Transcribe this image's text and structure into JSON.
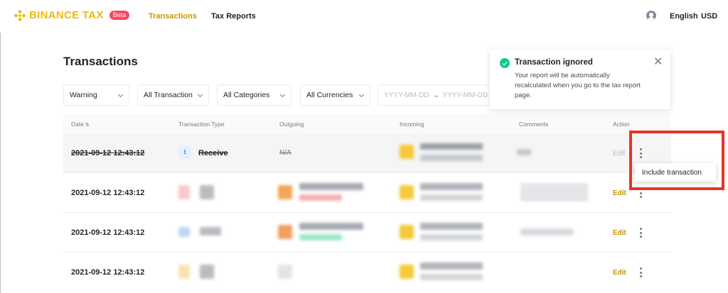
{
  "header": {
    "brand": "BINANCE TAX",
    "badge": "Beta",
    "nav": [
      "Transactions",
      "Tax Reports"
    ],
    "language": "English",
    "currency": "USD",
    "accent_color": "#F0B90B"
  },
  "page": {
    "title": "Transactions"
  },
  "filters": {
    "status": "Warning",
    "transaction": "All Transaction",
    "categories": "All Categories",
    "currencies": "All Currencies",
    "date_from_placeholder": "YYYY-MM-DD",
    "date_arrow": "→",
    "date_to_placeholder": "YYYY-MM-DD"
  },
  "table": {
    "columns": [
      "Date",
      "Transaction Type",
      "Outgoing",
      "Incoming",
      "Comments",
      "Action"
    ],
    "sort_icon": "⇅",
    "rows": [
      {
        "date": "2021-09-12  12:43:12",
        "type": "Receive",
        "outgoing": "N/A",
        "action": "Edit",
        "ignored": true
      },
      {
        "date": "2021-09-12  12:43:12",
        "action": "Edit",
        "ignored": false
      },
      {
        "date": "2021-09-12  12:43:12",
        "action": "Edit",
        "ignored": false
      },
      {
        "date": "2021-09-12  12:43:12",
        "action": "Edit",
        "ignored": false
      }
    ]
  },
  "menu": {
    "include": "Include transaction"
  },
  "toast": {
    "title": "Transaction ignored",
    "message": "Your report will be automatically recalculated when you go to the tax report page.",
    "close": "✕"
  }
}
